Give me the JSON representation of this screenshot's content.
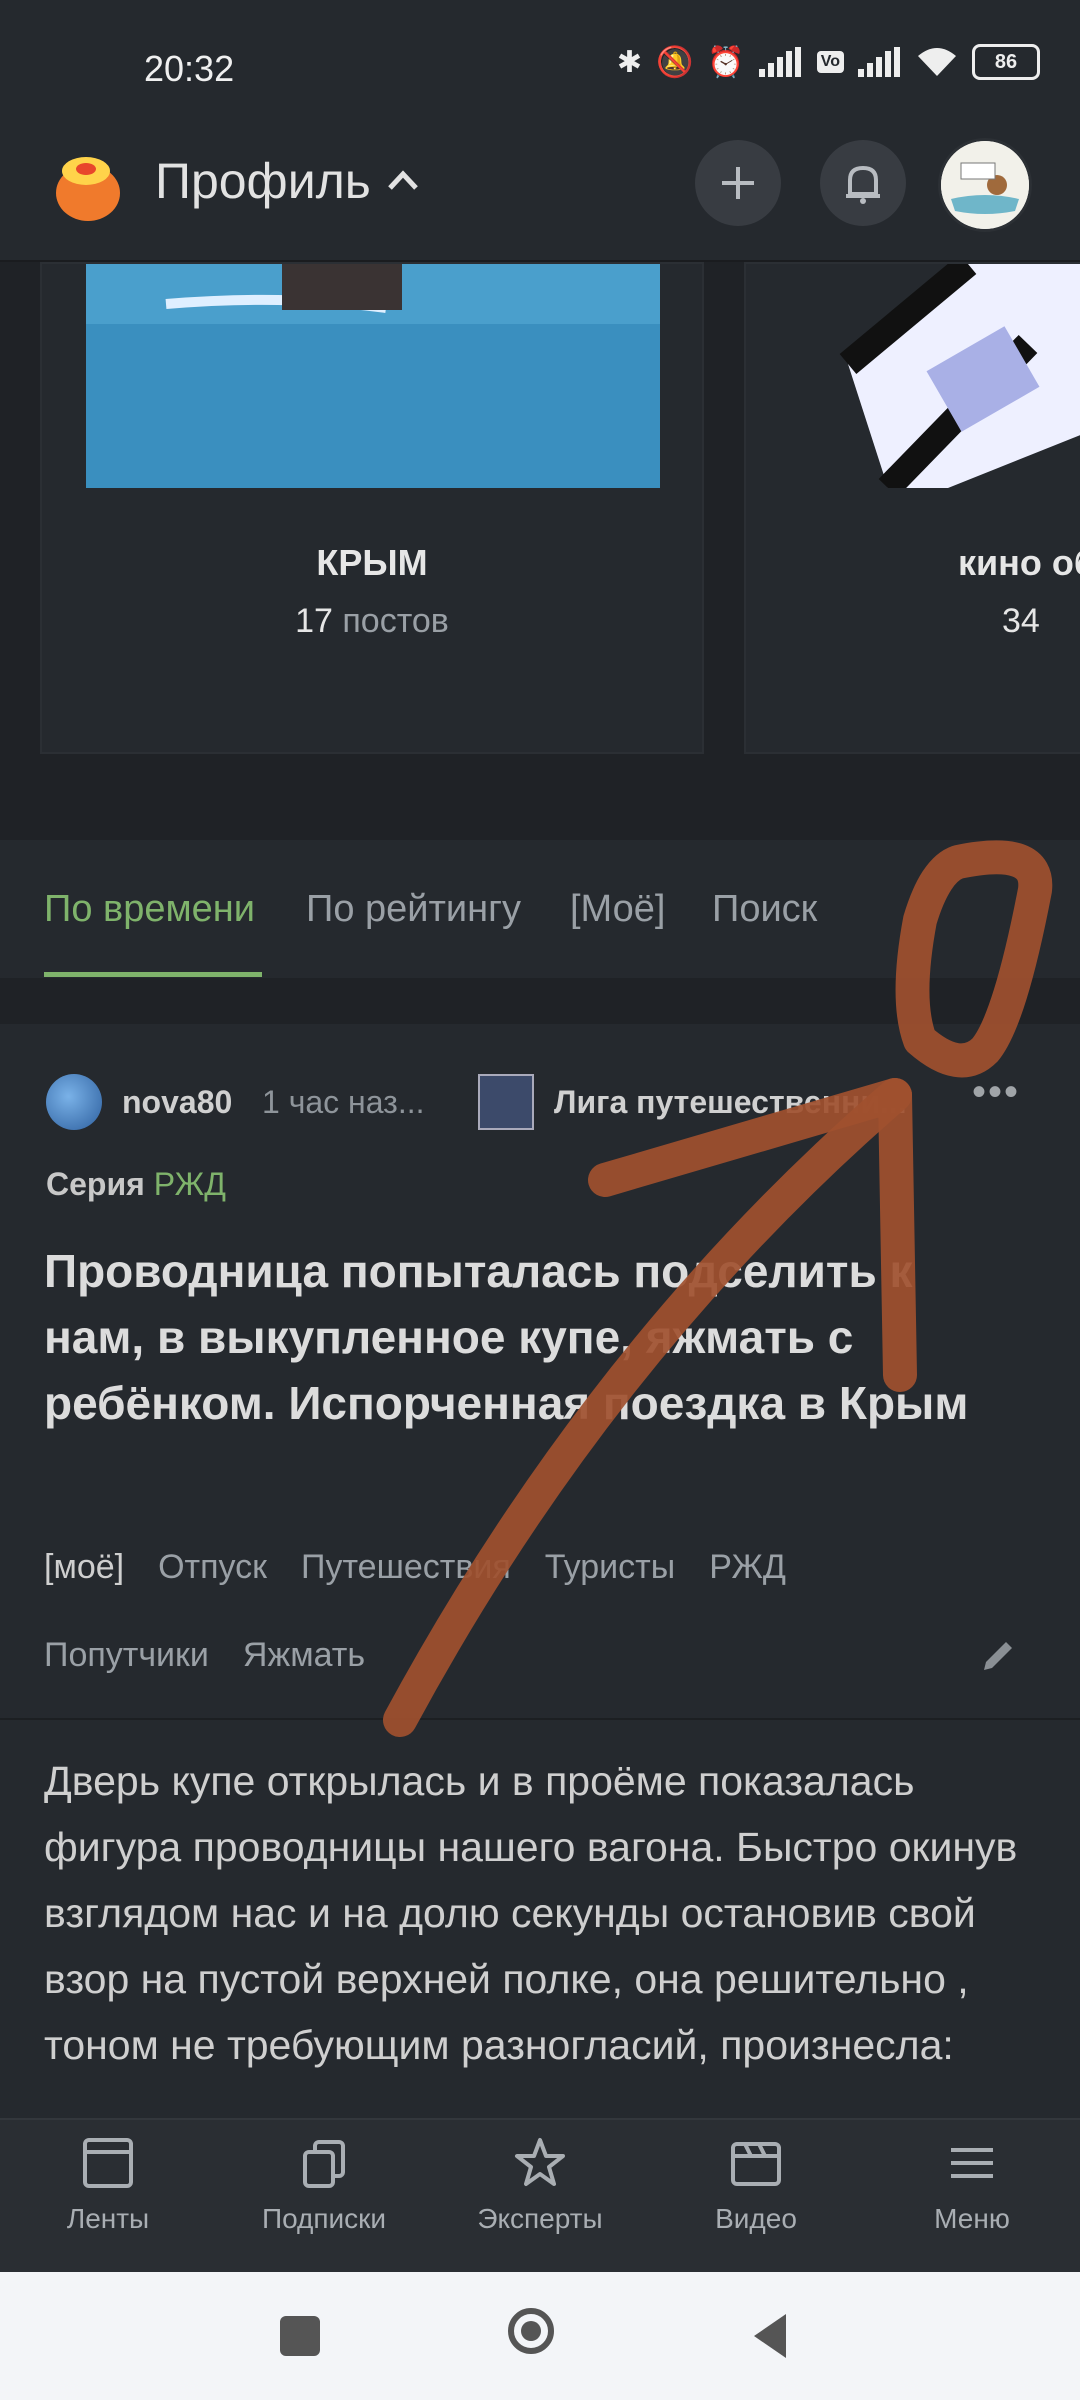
{
  "status": {
    "time": "20:32",
    "battery": "86"
  },
  "header": {
    "title": "Профиль"
  },
  "communities": [
    {
      "name": "КРЫМ",
      "count": "17",
      "count_label": "постов"
    },
    {
      "name": "кино об",
      "count": "34",
      "count_label": ""
    }
  ],
  "tabs": [
    "По времени",
    "По рейтингу",
    "[Моё]",
    "Поиск"
  ],
  "post": {
    "author": "nova80",
    "time": "1 час наз...",
    "community": "Лига путешественни...",
    "series_label": "Серия",
    "series_value": "РЖД",
    "title": "Проводница попыталась подселить к нам, в выкупленное купе, яжмать с ребёнком. Испорченная поездка в Крым",
    "tags_row1": [
      "[моё]",
      "Отпуск",
      "Путешествия",
      "Туристы",
      "РЖД"
    ],
    "tags_row2": [
      "Попутчики",
      "Яжмать"
    ],
    "body": "Дверь купе открылась и в проёме показалась фигура проводницы нашего вагона. Быстро окинув взглядом нас и на долю секунды остановив свой взор на пустой верхней полке, она решительно , тоном не требующим разногласий, произнесла:"
  },
  "bottom_nav": [
    "Ленты",
    "Подписки",
    "Эксперты",
    "Видео",
    "Меню"
  ],
  "colors": {
    "accent": "#7fb36b",
    "annotation": "#a0502f"
  }
}
